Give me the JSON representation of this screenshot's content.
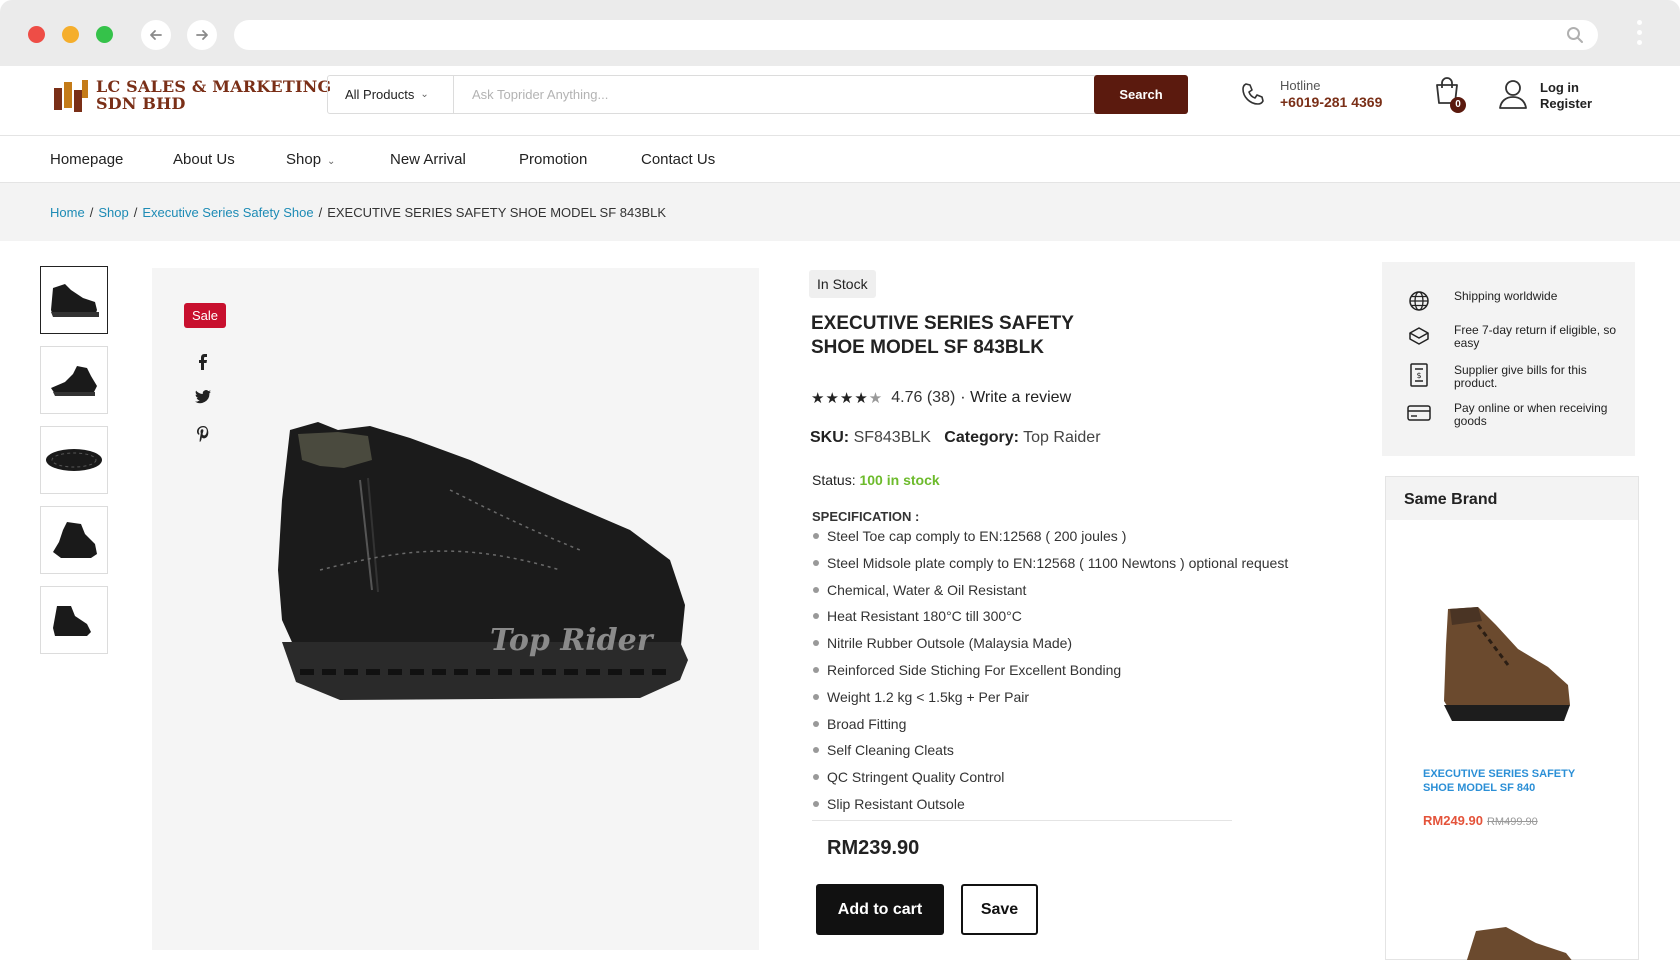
{
  "browser": {
    "url": ""
  },
  "header": {
    "logo_line1": "LC SALES & MARKETING",
    "logo_line2": "SDN BHD",
    "category_select": "All Products",
    "search_placeholder": "Ask Toprider Anything...",
    "search_button": "Search",
    "hotline_label": "Hotline",
    "hotline_number": "+6019-281 4369",
    "cart_count": "0",
    "login_label": "Log in",
    "register_label": "Register"
  },
  "nav": {
    "items": [
      "Homepage",
      "About Us",
      "Shop",
      "New Arrival",
      "Promotion",
      "Contact Us"
    ]
  },
  "breadcrumb": {
    "home": "Home",
    "shop": "Shop",
    "category": "Executive Series Safety Shoe",
    "current": "EXECUTIVE SERIES SAFETY SHOE MODEL SF 843BLK"
  },
  "product": {
    "sale_badge": "Sale",
    "stock_badge": "In Stock",
    "title_line1": "EXECUTIVE SERIES SAFETY",
    "title_line2": "SHOE MODEL SF 843BLK",
    "rating_value": "4.76 (38)",
    "rating_stars": 4.76,
    "write_review": "· Write a review",
    "sku_label": "SKU:",
    "sku_value": "SF843BLK",
    "category_label": "Category:",
    "category_value": "Top Raider",
    "status_label": "Status:",
    "status_value": "100 in stock",
    "spec_title": "SPECIFICATION :",
    "specs": [
      "Steel Toe cap comply to EN:12568 ( 200 joules )",
      "Steel Midsole plate comply to EN:12568 ( 1100 Newtons ) optional request",
      "Chemical, Water & Oil Resistant",
      "Heat Resistant 180°C till 300°C",
      "Nitrile Rubber Outsole (Malaysia Made)",
      "Reinforced Side Stiching For Excellent Bonding",
      "Weight 1.2 kg < 1.5kg + Per Pair",
      "Broad Fitting",
      "Self Cleaning Cleats",
      "QC Stringent Quality Control",
      "Slip Resistant Outsole"
    ],
    "price": "RM239.90",
    "add_to_cart": "Add to cart",
    "save": "Save",
    "image_watermark": "Top Rider"
  },
  "features": [
    {
      "icon": "globe-icon",
      "text": "Shipping worldwide"
    },
    {
      "icon": "return-box-icon",
      "text": "Free 7-day return if eligible, so easy"
    },
    {
      "icon": "bill-icon",
      "text": "Supplier give bills for this product."
    },
    {
      "icon": "credit-card-icon",
      "text": "Pay online or when receiving goods"
    }
  ],
  "same_brand": {
    "heading": "Same Brand",
    "product_name": "EXECUTIVE SERIES SAFETY SHOE MODEL SF 840",
    "price": "RM249.90",
    "old_price": "RM499.90"
  },
  "colors": {
    "brand": "#5b1a0e",
    "link": "#1d8bb5",
    "sale": "#c8102e",
    "in_stock": "#6dbb2c"
  }
}
